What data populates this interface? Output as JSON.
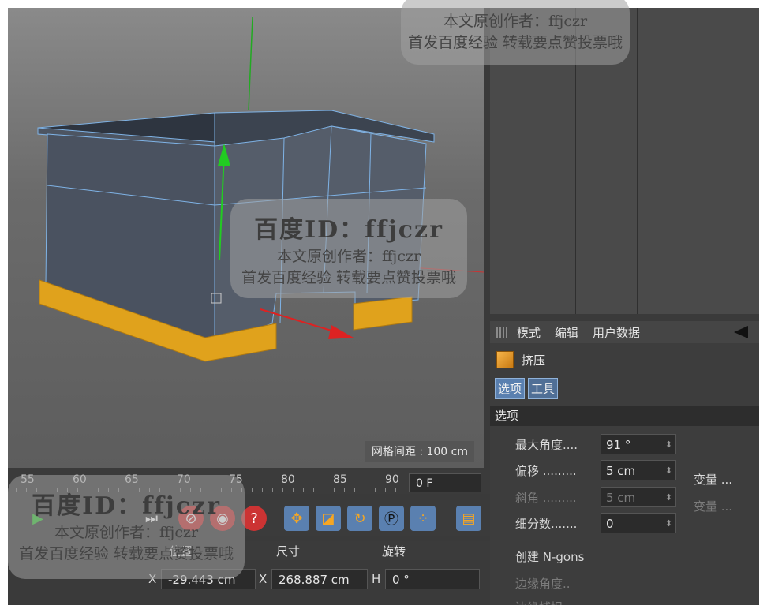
{
  "viewport": {
    "grid_label": "网格间距 : 100 cm"
  },
  "attributes": {
    "menu": [
      "模式",
      "编辑",
      "用户数据"
    ],
    "object_name": "挤压",
    "tabs": [
      "选项",
      "工具"
    ],
    "section": "选项",
    "params": [
      {
        "label": "最大角度....",
        "value": "91 °",
        "dim": false
      },
      {
        "label": "偏移 .........",
        "value": "5 cm",
        "dim": false
      },
      {
        "label": "斜角 .........",
        "value": "5 cm",
        "dim": true
      },
      {
        "label": "细分数.......",
        "value": "0",
        "dim": false
      }
    ],
    "right_labels": [
      {
        "label": "变量 ...",
        "dim": false
      },
      {
        "label": "变量 ...",
        "dim": true
      }
    ],
    "create_ngons": "创建 N-gons",
    "edge_angle": "边缘角度..",
    "edge_snap": "边缘捕捉"
  },
  "timeline": {
    "ticks": [
      "55",
      "60",
      "65",
      "70",
      "75",
      "80",
      "85",
      "90"
    ],
    "current_frame": "0 F"
  },
  "coords": {
    "headers": {
      "position": "位置",
      "size": "尺寸",
      "rotation": "旋转"
    },
    "row1": {
      "pos_axis": "X",
      "pos": "-29.443 cm",
      "size_axis": "X",
      "size": "268.887 cm",
      "rot_axis": "H",
      "rot": "0 °"
    }
  },
  "watermark": {
    "line1": "百度ID：ffjczr",
    "line2": "本文原创作者：ffjczr",
    "line3": "首发百度经验 转载要点赞投票哦"
  },
  "colors": {
    "selection_orange": "#e0a21c",
    "tab_blue": "#5a80b0",
    "axis_green": "#22cc22",
    "axis_red": "#dd2222"
  }
}
